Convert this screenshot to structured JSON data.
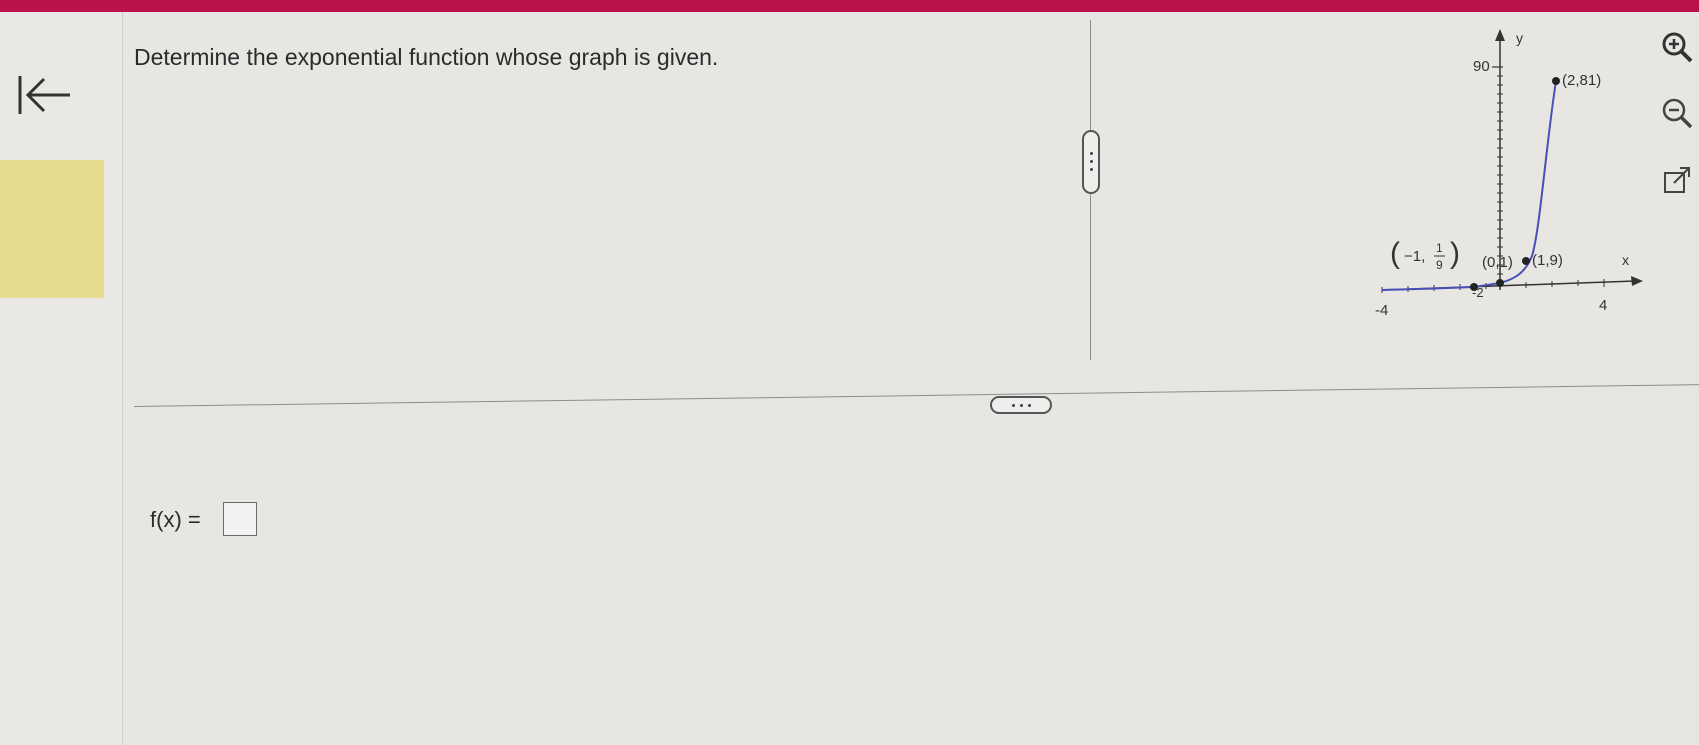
{
  "question": {
    "prompt": "Determine the exponential function whose graph is given.",
    "answer_label": "f(x) =",
    "answer_value": ""
  },
  "tools": [
    "zoom-in-icon",
    "zoom-out-icon",
    "open-external-icon"
  ],
  "colors": {
    "topbar": "#b8134a",
    "highlight": "#e6dc8f",
    "curve": "#4a4fb8"
  },
  "graph": {
    "y_axis_label": "y",
    "x_axis_label": "x",
    "y_tick_top": "90",
    "x_tick_left": "-4",
    "x_tick_right": "4",
    "x_tick_mid": "-2",
    "point_labels": {
      "p_minus1_prefix": "−1,",
      "p_minus1_num": "1",
      "p_minus1_den": "9",
      "p0": "(0,1)",
      "p1": "(1,9)",
      "p2": "(2,81)"
    }
  }
}
